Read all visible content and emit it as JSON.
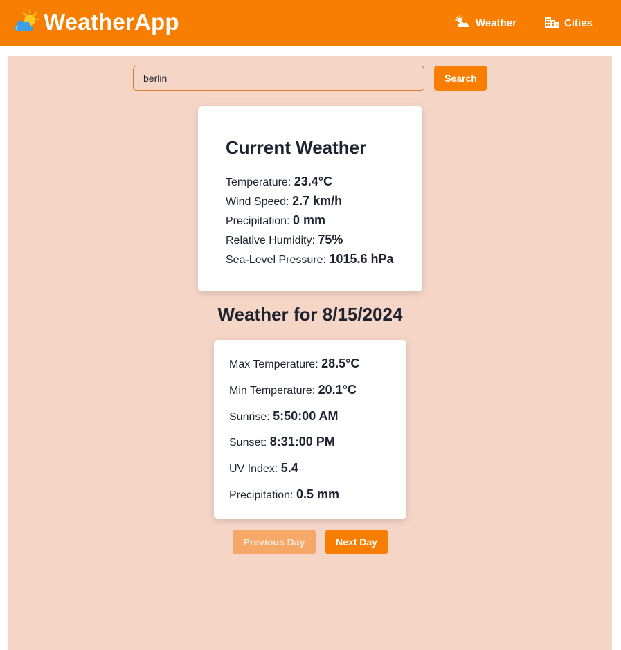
{
  "header": {
    "brand": "WeatherApp",
    "brand_icon": "sun-behind-cloud-icon",
    "nav": {
      "weather_label": "Weather",
      "weather_icon": "sun-cloud-icon",
      "cities_label": "Cities",
      "cities_icon": "city-buildings-icon"
    },
    "accent_color": "#f77e00"
  },
  "search": {
    "value": "berlin",
    "button_label": "Search"
  },
  "current_weather": {
    "title": "Current Weather",
    "rows": [
      {
        "label": "Temperature:",
        "value": "23.4°C"
      },
      {
        "label": "Wind Speed:",
        "value": "2.7 km/h"
      },
      {
        "label": "Precipitation:",
        "value": "0 mm"
      },
      {
        "label": "Relative Humidity:",
        "value": "75%"
      },
      {
        "label": "Sea-Level Pressure:",
        "value": "1015.6 hPa"
      }
    ]
  },
  "daily": {
    "title": "Weather for 8/15/2024",
    "rows": [
      {
        "label": "Max Temperature:",
        "value": "28.5°C"
      },
      {
        "label": "Min Temperature:",
        "value": "20.1°C"
      },
      {
        "label": "Sunrise:",
        "value": "5:50:00 AM"
      },
      {
        "label": "Sunset:",
        "value": "8:31:00 PM"
      },
      {
        "label": "UV Index:",
        "value": "5.4"
      },
      {
        "label": "Precipitation:",
        "value": "0.5 mm"
      }
    ]
  },
  "pager": {
    "prev_label": "Previous Day",
    "prev_disabled": true,
    "next_label": "Next Day"
  }
}
